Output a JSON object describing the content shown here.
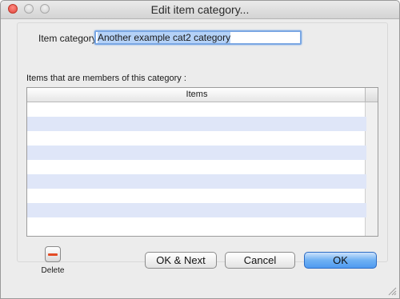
{
  "window": {
    "title": "Edit item category..."
  },
  "form": {
    "category_label": "Item category",
    "category_value": "Another example cat2 category"
  },
  "members": {
    "label": "Items that are members of this category :",
    "column_header": "Items",
    "rows": [
      "",
      "",
      "",
      "",
      "",
      "",
      "",
      "",
      ""
    ]
  },
  "buttons": {
    "delete_label": "Delete",
    "ok_next_label": "OK & Next",
    "cancel_label": "Cancel",
    "ok_label": "OK"
  },
  "icons": {
    "close": "close-dot-icon",
    "minimize": "minimize-dot-icon",
    "zoom": "zoom-dot-icon",
    "delete": "minus-icon",
    "resize": "resize-grip-icon"
  },
  "colors": {
    "row_alt": "#dfe6f8",
    "primary_button": "#4f9af0",
    "delete_accent": "#e34b25",
    "input_focus": "#7aa7e3"
  }
}
